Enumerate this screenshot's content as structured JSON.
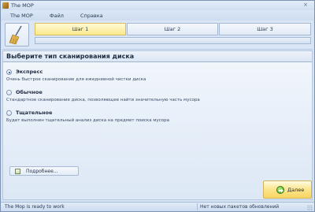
{
  "window": {
    "title": "The MOP",
    "close_symbol": "×",
    "icon": "broom-app-icon"
  },
  "menu": {
    "items": [
      {
        "label": "The MOP"
      },
      {
        "label": "Файл"
      },
      {
        "label": "Справка"
      }
    ]
  },
  "steps": {
    "items": [
      {
        "label": "Шаг 1",
        "active": true
      },
      {
        "label": "Шаг 2",
        "active": false
      },
      {
        "label": "Шаг 3",
        "active": false
      }
    ],
    "progress": 0
  },
  "scan": {
    "heading": "Выберите тип сканирования диска",
    "selected": "express",
    "options": [
      {
        "id": "express",
        "title": "Экспресс",
        "description": "Очень быстрое сканирование для ежедневной чистки диска"
      },
      {
        "id": "normal",
        "title": "Обычное",
        "description": "Стандартное сканирование диска, позволяющее найти значительную часть мусора"
      },
      {
        "id": "thorough",
        "title": "Тщательное",
        "description": "Будет выполнен тщательный анализ диска на предмет поиска мусора"
      }
    ]
  },
  "buttons": {
    "details_label": "Подробнее...",
    "next_label": "Далее"
  },
  "status": {
    "left": "The Mop is ready to work",
    "right": "Нет новых пакетов обновлений"
  },
  "colors": {
    "active_step": "#fbe98d",
    "next_button": "#f8d663",
    "frame": "#c9d9ee"
  }
}
